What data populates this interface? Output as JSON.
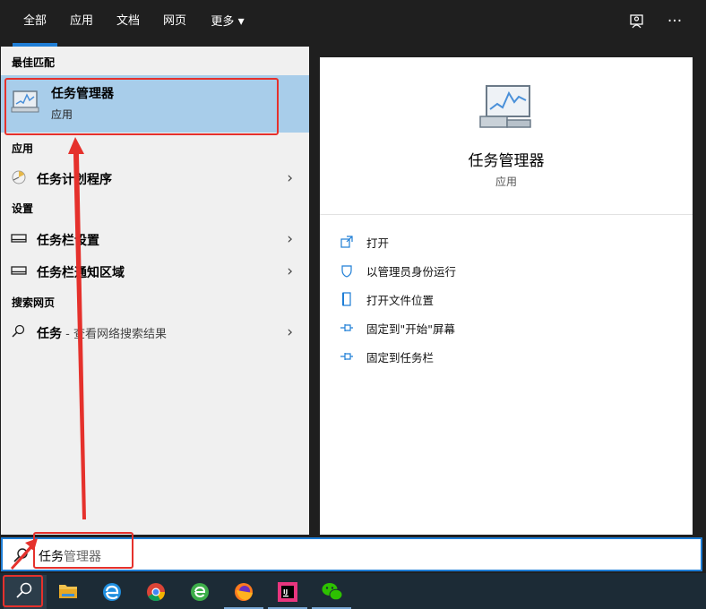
{
  "tabs": [
    {
      "label": "全部",
      "active": true
    },
    {
      "label": "应用",
      "active": false
    },
    {
      "label": "文档",
      "active": false
    },
    {
      "label": "网页",
      "active": false
    },
    {
      "label": "更多",
      "active": false
    }
  ],
  "more_arrow": "▾",
  "top_icons": {
    "feedback": "feedback-icon",
    "more": "···"
  },
  "left": {
    "best_match_head": "最佳匹配",
    "best_match": {
      "title": "任务管理器",
      "subtitle": "应用"
    },
    "apps_head": "应用",
    "apps": [
      {
        "label": "任务计划程序"
      }
    ],
    "settings_head": "设置",
    "settings": [
      {
        "label": "任务栏设置"
      },
      {
        "label": "任务栏通知区域"
      }
    ],
    "web_head": "搜索网页",
    "web": [
      {
        "label": "任务",
        "suffix": " - 查看网络搜索结果"
      }
    ],
    "chevron": "›"
  },
  "right": {
    "title": "任务管理器",
    "subtitle": "应用",
    "actions": [
      {
        "label": "打开",
        "icon": "open-icon"
      },
      {
        "label": "以管理员身份运行",
        "icon": "shield-icon"
      },
      {
        "label": "打开文件位置",
        "icon": "file-location-icon"
      },
      {
        "label": "固定到\"开始\"屏幕",
        "icon": "pin-icon"
      },
      {
        "label": "固定到任务栏",
        "icon": "pin-icon"
      }
    ]
  },
  "search": {
    "typed": "任务",
    "completion": "管理器"
  },
  "colors": {
    "accent": "#1f7ed6",
    "highlight": "#a8cdea",
    "annotation": "#e5312c",
    "topbar": "#1f1f1f",
    "taskbar": "#1c2b36"
  },
  "taskbar": [
    {
      "name": "search-icon",
      "running": false
    },
    {
      "name": "file-explorer-icon",
      "running": false
    },
    {
      "name": "edge-icon",
      "running": false
    },
    {
      "name": "chrome-icon",
      "running": false
    },
    {
      "name": "browser-green-icon",
      "running": false
    },
    {
      "name": "firefox-icon",
      "running": true
    },
    {
      "name": "intellij-icon",
      "running": true
    },
    {
      "name": "wechat-icon",
      "running": true
    }
  ]
}
